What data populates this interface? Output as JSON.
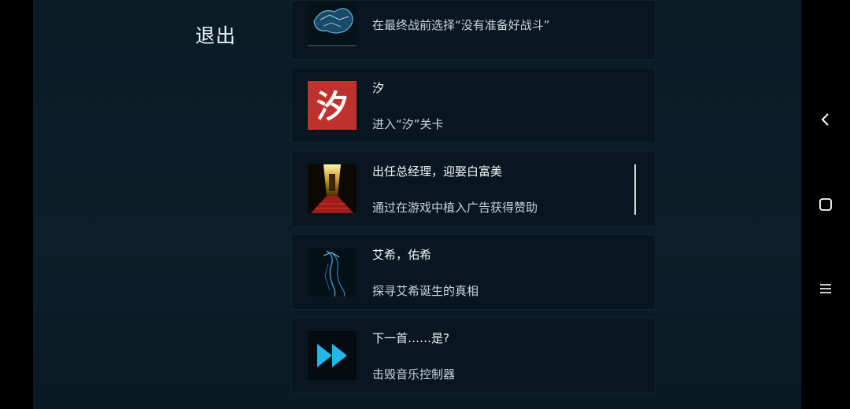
{
  "header": {
    "exit_label": "退出"
  },
  "achievements": [
    {
      "title": "",
      "desc": "在最终战前选择“没有准备好战斗”",
      "icon": "crystal-creature-icon"
    },
    {
      "title": "汐",
      "desc": "进入“汐”关卡",
      "icon": "xi-character-icon",
      "icon_glyph": "汐"
    },
    {
      "title": "出任总经理，迎娶白富美",
      "desc": "通过在游戏中植入广告获得赞助",
      "icon": "golden-door-red-carpet-icon"
    },
    {
      "title": "艾希，佑希",
      "desc": "探寻艾希诞生的真相",
      "icon": "blue-wireframe-figure-icon"
    },
    {
      "title": "下一首……是?",
      "desc": "击毁音乐控制器",
      "icon": "fast-forward-icon"
    }
  ],
  "navigation": {
    "back": "back-icon",
    "home": "home-icon",
    "recents": "recents-icon"
  },
  "colors": {
    "background": "#0a1c26",
    "card": "#081620",
    "accent": "#27b4e6",
    "xi_red": "#c0302c"
  }
}
